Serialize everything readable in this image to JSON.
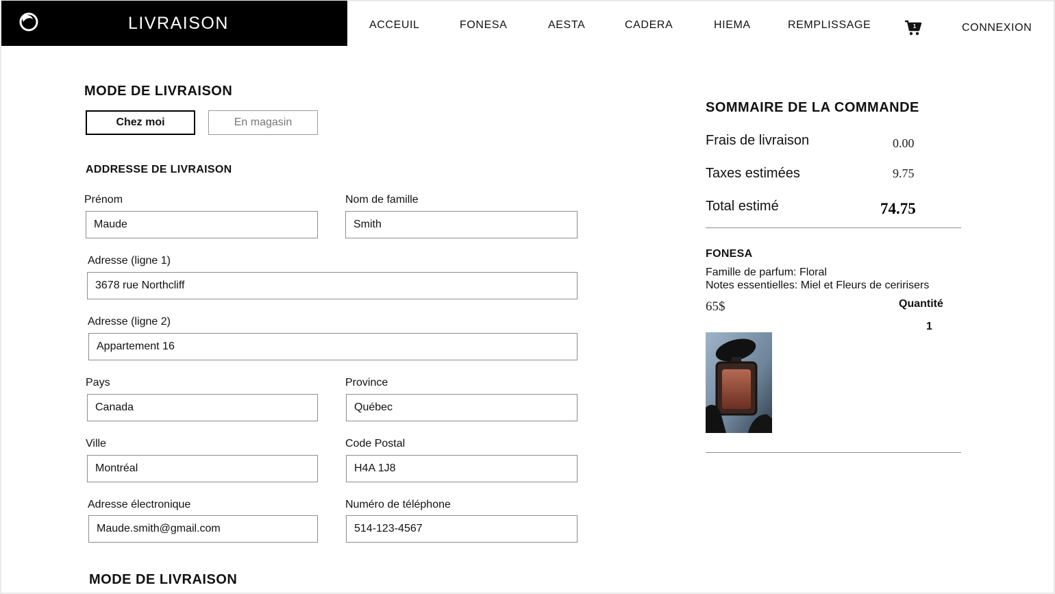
{
  "header": {
    "brand_title": "LIVRAISON",
    "nav": [
      "ACCEUIL",
      "FONESA",
      "AESTA",
      "CADERA",
      "HIEMA",
      "REMPLISSAGE"
    ],
    "cart_badge": "1",
    "login": "CONNEXION"
  },
  "delivery_mode": {
    "title": "MODE DE LIVRAISON",
    "options": [
      "Chez moi",
      "En magasin"
    ],
    "selected": "Chez moi"
  },
  "address": {
    "title": "ADDRESSE DE LIVRAISON",
    "fields": {
      "first_name": {
        "label": "Prénom",
        "value": "Maude"
      },
      "last_name": {
        "label": "Nom de famille",
        "value": "Smith"
      },
      "address1": {
        "label": "Adresse (ligne 1)",
        "value": "3678 rue Northcliff"
      },
      "address2": {
        "label": "Adresse (ligne 2)",
        "value": "Appartement 16"
      },
      "country": {
        "label": "Pays",
        "value": "Canada"
      },
      "province": {
        "label": "Province",
        "value": "Québec"
      },
      "city": {
        "label": "Ville",
        "value": "Montréal"
      },
      "postal": {
        "label": "Code Postal",
        "value": "H4A 1J8"
      },
      "email": {
        "label": "Adresse électronique",
        "value": "Maude.smith@gmail.com"
      },
      "phone": {
        "label": "Numéro de téléphone",
        "value": "514-123-4567"
      }
    }
  },
  "bottom_title": "MODE DE LIVRAISON",
  "summary": {
    "title": "SOMMAIRE DE LA COMMANDE",
    "shipping_label": "Frais de livraison",
    "shipping_value": "0.00",
    "taxes_label": "Taxes estimées",
    "taxes_value": "9.75",
    "total_label": "Total estimé",
    "total_value": "74.75"
  },
  "product": {
    "name": "FONESA",
    "family": "Famille de parfum: Floral",
    "notes": "Notes essentielles:  Miel et Fleurs de ceririsers",
    "price": "65$",
    "qty_label": "Quantité",
    "qty": "1"
  },
  "colors": {
    "brand_bg": "#000000",
    "border": "#8c8c8c"
  }
}
